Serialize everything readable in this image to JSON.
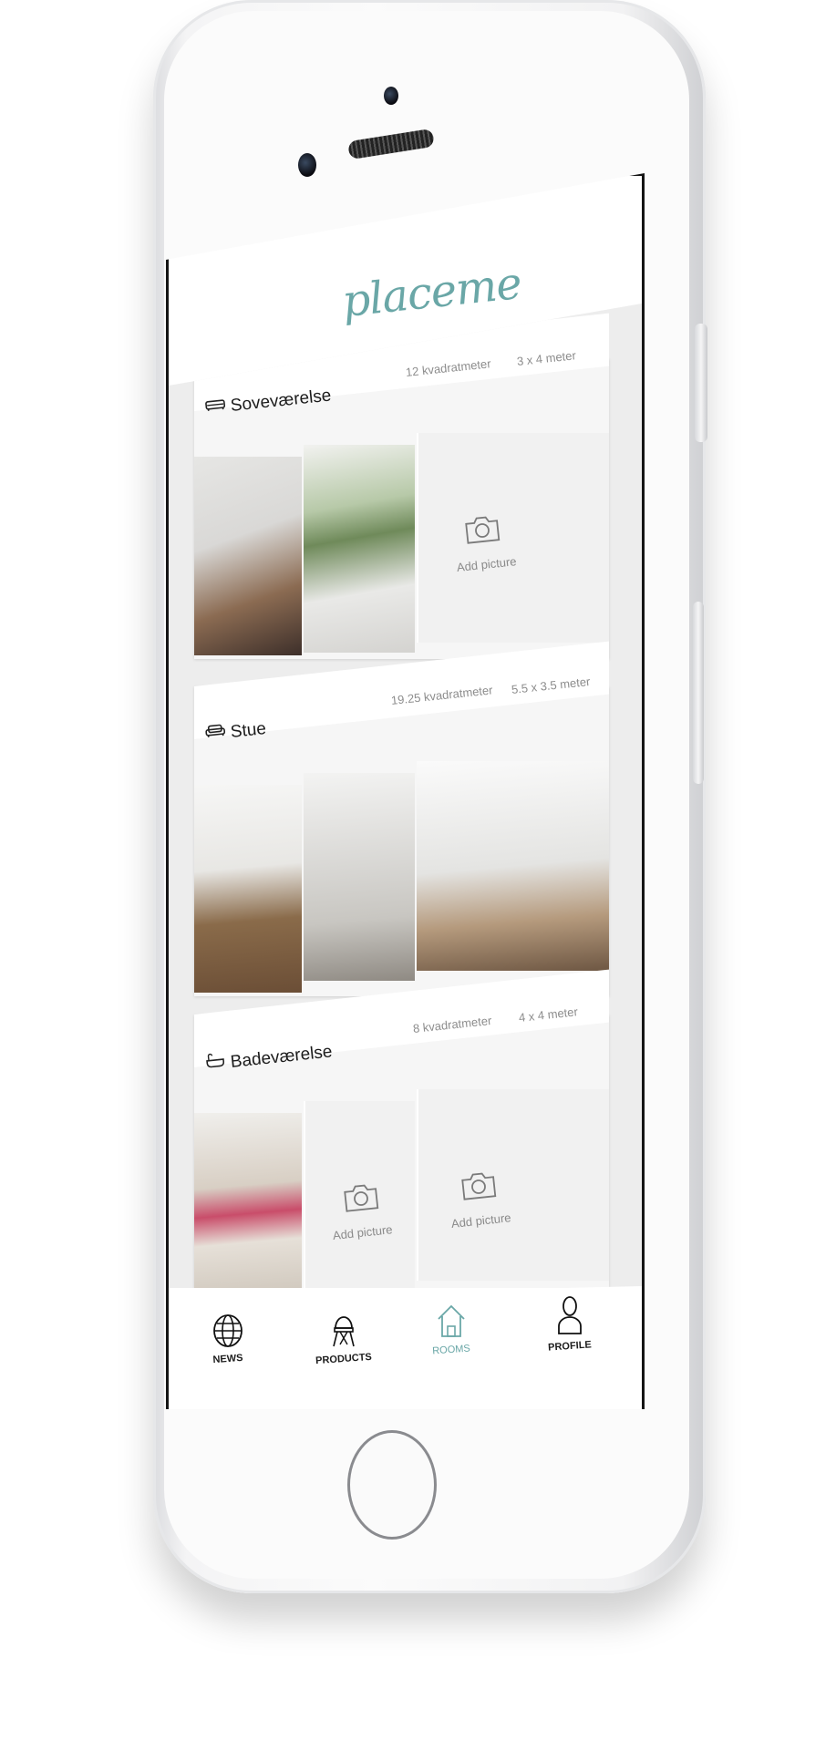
{
  "app": {
    "logo": "placeme",
    "accent_color": "#6aa7a7"
  },
  "rooms": [
    {
      "name": "Soveværelse",
      "icon": "bed-icon",
      "area": "12 kvadratmeter",
      "dimensions": "3 x 4 meter",
      "tiles": [
        "photo",
        "photo",
        "add"
      ]
    },
    {
      "name": "Stue",
      "icon": "sofa-icon",
      "area": "19.25 kvadratmeter",
      "dimensions": "5.5 x 3.5 meter",
      "tiles": [
        "photo",
        "photo",
        "photo"
      ]
    },
    {
      "name": "Badeværelse",
      "icon": "bathtub-icon",
      "area": "8 kvadratmeter",
      "dimensions": "4 x 4 meter",
      "tiles": [
        "photo",
        "add",
        "add"
      ]
    }
  ],
  "add_picture_label": "Add picture",
  "tabs": [
    {
      "label": "NEWS",
      "icon": "globe-icon",
      "active": false
    },
    {
      "label": "PRODUCTS",
      "icon": "chair-icon",
      "active": false
    },
    {
      "label": "ROOMS",
      "icon": "house-icon",
      "active": true
    },
    {
      "label": "PROFILE",
      "icon": "person-icon",
      "active": false
    }
  ]
}
